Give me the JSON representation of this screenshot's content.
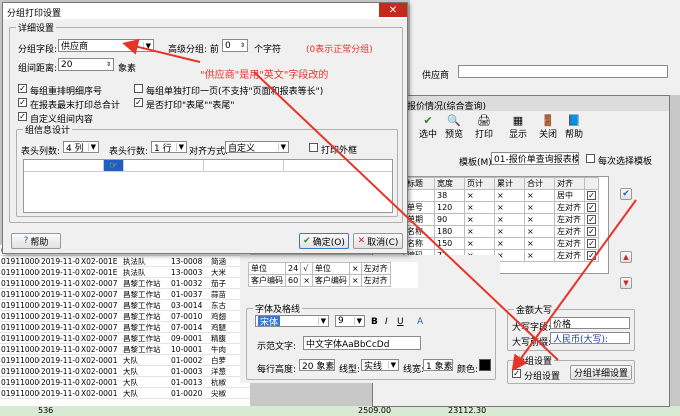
{
  "bg_top": {
    "supplier_label": "供应商",
    "rows": [
      [
        "0191100005",
        "2019-11-04",
        "X02-001E",
        "执法队",
        "13-0008",
        "袁香"
      ],
      [
        "0191100005",
        "2019-11-04",
        "X02-001E",
        "执法队",
        "13-0008",
        "简涵"
      ],
      [
        "0191100005",
        "2019-11-04",
        "X02-001E",
        "执法队",
        "13-0003",
        "大米"
      ],
      [
        "0191100008",
        "2019-11-04",
        "X02-0007",
        "昌黎工作站",
        "01-0032",
        "茄子"
      ],
      [
        "0191100008",
        "2019-11-04",
        "X02-0007",
        "昌黎工作站",
        "01-0037",
        "蒜苗"
      ],
      [
        "0191100008",
        "2019-11-04",
        "X02-0007",
        "昌黎工作站",
        "03-0014",
        "东古"
      ],
      [
        "0191100008",
        "2019-11-04",
        "X02-0007",
        "昌黎工作站",
        "07-0010",
        "鸡翅"
      ],
      [
        "0191100008",
        "2019-11-04",
        "X02-0007",
        "昌黎工作站",
        "07-0014",
        "鸡腿"
      ],
      [
        "0191100008",
        "2019-11-04",
        "X02-0007",
        "昌黎工作站",
        "09-0001",
        "精腹"
      ],
      [
        "0191100008",
        "2019-11-04",
        "X02-0007",
        "昌黎工作站",
        "10-0001",
        "牛肉"
      ],
      [
        "0191100006",
        "2019-11-04",
        "X02-0001",
        "大队",
        "01-0002",
        "白萝"
      ],
      [
        "0191100006",
        "2019-11-04",
        "X02-0001",
        "大队",
        "01-0003",
        "洋葱"
      ],
      [
        "0191100006",
        "2019-11-04",
        "X02-0001",
        "大队",
        "01-0013",
        "杭椒"
      ],
      [
        "0191100006",
        "2019-11-04",
        "X02-0001",
        "大队",
        "01-0020",
        "尖椒"
      ]
    ],
    "footer": [
      "536",
      "2509.00",
      "23112.30"
    ]
  },
  "report_win": {
    "title": "报价情况(综合查询)",
    "toolbar": [
      "选中",
      "预览",
      "打印",
      "显示",
      "关闭",
      "帮助"
    ],
    "template_label": "模板(M)",
    "template_value": "01-报价单查询报表模板",
    "each_select": "每次选择模板",
    "grid_headers": [
      "标题",
      "宽度",
      "页计",
      "累计",
      "合计",
      "对齐"
    ],
    "grid_rows": [
      [
        "",
        "38",
        "×",
        "×",
        "×",
        "居中"
      ],
      [
        "单号",
        "120",
        "×",
        "×",
        "×",
        "左对齐"
      ],
      [
        "单期",
        "90",
        "×",
        "×",
        "×",
        "左对齐"
      ],
      [
        "名称",
        "180",
        "×",
        "×",
        "×",
        "左对齐"
      ],
      [
        "名称",
        "150",
        "×",
        "×",
        "×",
        "左对齐"
      ],
      [
        "编码",
        "72",
        "×",
        "×",
        "×",
        "左对齐"
      ]
    ],
    "left_rows": [
      [
        "单位",
        "24",
        "√",
        "单位"
      ],
      [
        "客户编码",
        "60",
        "×",
        "客户编码"
      ]
    ],
    "left_rows2": [
      "×",
      "左对齐"
    ],
    "font_group": "字体及格线",
    "font_name": "宋体",
    "font_size": "9",
    "font_buttons": [
      "B",
      "I",
      "U",
      "A"
    ],
    "sample_label": "示范文字:",
    "sample_text": "中文字体AaBbCcDd",
    "row_height_label": "每行高度:",
    "row_height": "20 象素",
    "line_type_label": "线型:",
    "line_type": "实线",
    "line_width_label": "线宽:",
    "line_width": "1 象素",
    "color_label": "颜色:",
    "amount_group": "金额大写",
    "upper_label": "大写字段:",
    "upper_value": "价格",
    "upper_prefix_label": "大写前缀:",
    "upper_prefix": "人民币(大写):",
    "group_group": "分组设置",
    "group_check": "分组设置",
    "group_detail_btn": "分组详细设置"
  },
  "dialog": {
    "title": "分组打印设置",
    "detail_group": "详细设置",
    "group_field_label": "分组字段:",
    "group_field_value": "供应商",
    "advanced_label": "高级分组: 前",
    "advanced_value": "0",
    "chars": "个字符",
    "normal_hint": "(0表示正常分组)",
    "spacing_label": "组间距离:",
    "spacing_value": "20",
    "spacing_unit": "象素",
    "annotation": "\"供应商\"是用\"英文\"字段改的",
    "check_reorder": "每组重排明细序号",
    "check_single_page": "每组单独打印一页(不支持\"页面和报表等长\")",
    "check_total": "在报表最末打印总合计",
    "check_tail": "是否打印\"表尾\"\"表尾\"",
    "check_custom": "自定义组间内容",
    "info_group": "组信息设计",
    "header_rows_label": "表头列数:",
    "header_rows_value": "4 列",
    "header_lines_label": "表头行数:",
    "header_lines_value": "1 行",
    "align_label": "对齐方式:",
    "align_value": "自定义",
    "print_frame": "打印外框",
    "help": "帮助",
    "ok": "确定(O)",
    "cancel": "取消(C)"
  }
}
